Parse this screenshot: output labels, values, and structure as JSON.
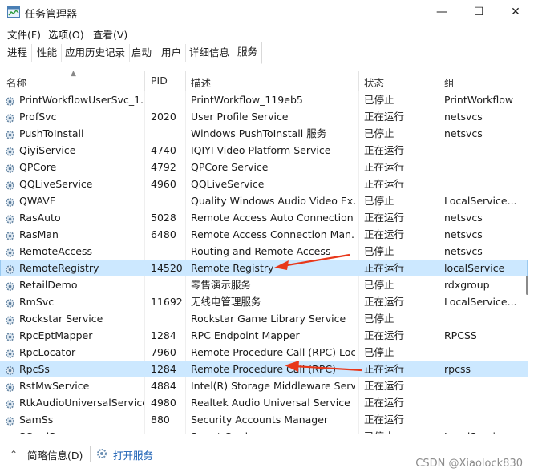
{
  "window": {
    "title": "任务管理器",
    "minimize_glyph": "—",
    "maximize_glyph": "☐",
    "close_glyph": "✕"
  },
  "menu": [
    "文件(F)",
    "选项(O)",
    "查看(V)"
  ],
  "tabs": [
    "进程",
    "性能",
    "应用历史记录",
    "启动",
    "用户",
    "详细信息",
    "服务"
  ],
  "active_tab": "服务",
  "columns": {
    "name": "名称",
    "pid": "PID",
    "desc": "描述",
    "status": "状态",
    "group": "组"
  },
  "rows": [
    {
      "name": "PrintWorkflowUserSvc_1...",
      "pid": "",
      "desc": "PrintWorkflow_119eb5",
      "status": "已停止",
      "group": "PrintWorkflow"
    },
    {
      "name": "ProfSvc",
      "pid": "2020",
      "desc": "User Profile Service",
      "status": "正在运行",
      "group": "netsvcs"
    },
    {
      "name": "PushToInstall",
      "pid": "",
      "desc": "Windows PushToInstall 服务",
      "status": "已停止",
      "group": "netsvcs"
    },
    {
      "name": "QiyiService",
      "pid": "4740",
      "desc": "IQIYI Video Platform Service",
      "status": "正在运行",
      "group": ""
    },
    {
      "name": "QPCore",
      "pid": "4792",
      "desc": "QPCore Service",
      "status": "正在运行",
      "group": ""
    },
    {
      "name": "QQLiveService",
      "pid": "4960",
      "desc": "QQLiveService",
      "status": "正在运行",
      "group": ""
    },
    {
      "name": "QWAVE",
      "pid": "",
      "desc": "Quality Windows Audio Video Ex...",
      "status": "已停止",
      "group": "LocalService..."
    },
    {
      "name": "RasAuto",
      "pid": "5028",
      "desc": "Remote Access Auto Connection ...",
      "status": "正在运行",
      "group": "netsvcs"
    },
    {
      "name": "RasMan",
      "pid": "6480",
      "desc": "Remote Access Connection Man...",
      "status": "正在运行",
      "group": "netsvcs"
    },
    {
      "name": "RemoteAccess",
      "pid": "",
      "desc": "Routing and Remote Access",
      "status": "已停止",
      "group": "netsvcs"
    },
    {
      "name": "RemoteRegistry",
      "pid": "14520",
      "desc": "Remote Registry",
      "status": "正在运行",
      "group": "localService"
    },
    {
      "name": "RetailDemo",
      "pid": "",
      "desc": "零售演示服务",
      "status": "已停止",
      "group": "rdxgroup"
    },
    {
      "name": "RmSvc",
      "pid": "11692",
      "desc": "无线电管理服务",
      "status": "正在运行",
      "group": "LocalService..."
    },
    {
      "name": "Rockstar Service",
      "pid": "",
      "desc": "Rockstar Game Library Service",
      "status": "已停止",
      "group": ""
    },
    {
      "name": "RpcEptMapper",
      "pid": "1284",
      "desc": "RPC Endpoint Mapper",
      "status": "正在运行",
      "group": "RPCSS"
    },
    {
      "name": "RpcLocator",
      "pid": "7960",
      "desc": "Remote Procedure Call (RPC) Loc...",
      "status": "已停止",
      "group": ""
    },
    {
      "name": "RpcSs",
      "pid": "1284",
      "desc": "Remote Procedure Call (RPC)",
      "status": "正在运行",
      "group": "rpcss"
    },
    {
      "name": "RstMwService",
      "pid": "4884",
      "desc": "Intel(R) Storage Middleware Serv...",
      "status": "正在运行",
      "group": ""
    },
    {
      "name": "RtkAudioUniversalService",
      "pid": "4980",
      "desc": "Realtek Audio Universal Service",
      "status": "正在运行",
      "group": ""
    },
    {
      "name": "SamSs",
      "pid": "880",
      "desc": "Security Accounts Manager",
      "status": "正在运行",
      "group": ""
    },
    {
      "name": "SCardSvr",
      "pid": "",
      "desc": "Smart Card",
      "status": "已停止",
      "group": "LocalService..."
    }
  ],
  "footer": {
    "details": "简略信息(D)",
    "open_services": "打开服务"
  },
  "watermark": "CSDN @Xiaolock830",
  "colors": {
    "selection": "#cce8ff",
    "arrow": "#e8381b"
  }
}
